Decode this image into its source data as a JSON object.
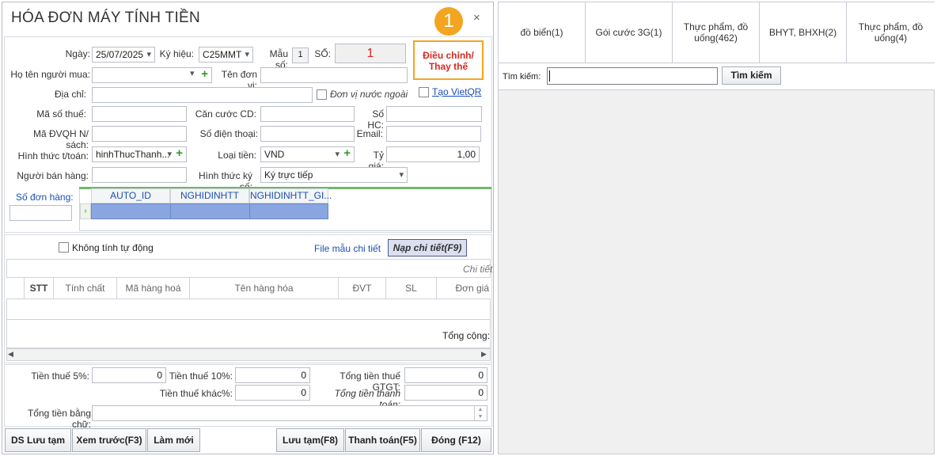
{
  "window": {
    "title": "HÓA ĐƠN MÁY TÍNH TIỀN",
    "close_glyph": "×",
    "badge": "1",
    "adjust_button": "Điều chỉnh/ Thay thế"
  },
  "header": {
    "date_label": "Ngày:",
    "date": "25/07/2025",
    "symbol_label": "Ký hiệu:",
    "symbol": "C25MMT",
    "form_label": "Mẫu số:",
    "form": "1",
    "number_label": "SỐ:",
    "number": "1",
    "buyer_label": "Họ tên người mua:",
    "buyer": "",
    "unit_label": "Tên đơn vị:",
    "unit": "",
    "address_label": "Địa chỉ:",
    "address": "",
    "foreign_label": "Đơn vị nước ngoài",
    "vietqr_label": "Tạo VietQR",
    "tax_label": "Mã số thuế:",
    "tax": "",
    "id_label": "Căn cước CD:",
    "id": "",
    "hc_label": "Số HC:",
    "hc": "",
    "budget_label": "Mã ĐVQH N/ sách:",
    "budget": "",
    "phone_label": "Số điện thoại:",
    "phone": "",
    "email_label": "Email:",
    "email": "",
    "payment_label": "Hình thức t/toán:",
    "payment": "hinhThucThanh...",
    "currency_label": "Loại tiền:",
    "currency": "VND",
    "rate_label": "Tỷ giá:",
    "rate": "1,00",
    "seller_label": "Người bán hàng:",
    "seller": "",
    "sign_label": "Hình thức ký số:",
    "sign": "Ký trực tiếp"
  },
  "orders": {
    "label": "Số đơn hàng:",
    "columns": [
      "AUTO_ID",
      "NGHIDINHTT",
      "NGHIDINHTT_GI..."
    ]
  },
  "detail": {
    "auto_calc": "Không tính tự động",
    "template_link": "File mẫu chi tiết",
    "load_button": "Nạp chi tiết(F9)",
    "group_header": "Chi tiết",
    "columns": [
      "STT",
      "Tính chất",
      "Mã hàng hoá",
      "Tên hàng hóa",
      "ĐVT",
      "SL",
      "Đơn giá"
    ],
    "total_label": "Tổng cộng:"
  },
  "totals": {
    "vat5_label": "Tiền thuế 5%:",
    "vat5": "0",
    "vat10_label": "Tiền thuế 10%:",
    "vat10": "0",
    "vat_total_label": "Tổng tiền thuế GTGT:",
    "vat_total": "0",
    "other_label": "Tiền thuế khác%:",
    "other": "0",
    "pay_total_label": "Tổng tiền thanh toán:",
    "pay_total": "0",
    "words_label": "Tổng tiền bằng chữ:",
    "words": ""
  },
  "footer": {
    "draft_list": "DS Lưu tạm",
    "preview": "Xem trước(F3)",
    "refresh": "Làm mới",
    "save_draft": "Lưu tạm(F8)",
    "pay": "Thanh toán(F5)",
    "close": "Đóng (F12)"
  },
  "categories": [
    "đồ biển(1)",
    "Gói cước 3G(1)",
    "Thực phẩm, đồ uống(462)",
    "BHYT, BHXH(2)",
    "Thực phẩm, đồ uống(4)"
  ],
  "search": {
    "label": "Tìm kiếm:",
    "value": "",
    "button": "Tìm kiếm"
  }
}
